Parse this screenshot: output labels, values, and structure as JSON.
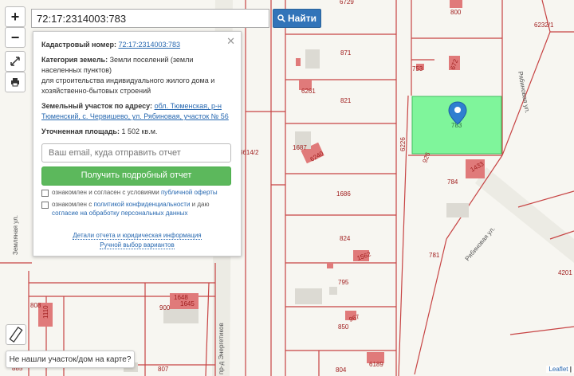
{
  "search": {
    "value": "72:17:2314003:783",
    "button_label": "Найти"
  },
  "zoom": {
    "in_label": "+",
    "out_label": "−"
  },
  "panel": {
    "cadastral_label": "Кадастровый номер:",
    "cadastral_value": "72:17:2314003:783",
    "category_label": "Категория земель:",
    "category_value": "Земли поселений (земли населенных пунктов)",
    "purpose_text": "для строительства индивидуального жилого дома и хозяйственно-бытовых строений",
    "address_label": "Земельный участок по адресу:",
    "address_value": "обл. Тюменская, р-н Тюменский, с. Червишево, ул. Рябиновая, участок № 56",
    "area_label": "Уточненная площадь:",
    "area_value": "1 502 кв.м.",
    "email_placeholder": "Ваш email, куда отправить отчет",
    "get_report": "Получить подробный отчет",
    "agree1_text": "ознакомлен и согласен с условиями",
    "agree1_link": "публичной оферты",
    "agree2_text1": "ознакомлен с",
    "agree2_link1": "политикой конфиденциальности",
    "agree2_text2": "и даю",
    "agree2_link2": "согласие на обработку персональных данных",
    "details_link": "Детали отчета и юридическая информация",
    "manual_link": "Ручной выбор вариантов"
  },
  "not_found": "Не нашли участок/дом на карте?",
  "attribution": {
    "leaflet": "Leaflet",
    "sep": "|"
  },
  "map_labels": {
    "parcels": [
      "800",
      "871",
      "821",
      "1686",
      "824",
      "795",
      "850",
      "900",
      "807",
      "804",
      "781",
      "784",
      "783",
      "753",
      "6232/1",
      "4201",
      "3614/2",
      "1687",
      "808",
      "885",
      "6226"
    ],
    "houses": [
      "6261",
      "6240",
      "1562",
      "967",
      "1648",
      "1110",
      "1433",
      "926",
      "672",
      "6189",
      "6729"
    ],
    "streets": [
      "Рябиновая ул.",
      "Рябиновая ул.",
      "Земляная ул.",
      "пр-д Энергетиков"
    ]
  },
  "colors": {
    "highlight": "#7ff59b",
    "house": "#e07a7a",
    "parcel_line": "#c0392b",
    "marker": "#2f7fd0",
    "accent_btn": "#3274b9"
  }
}
